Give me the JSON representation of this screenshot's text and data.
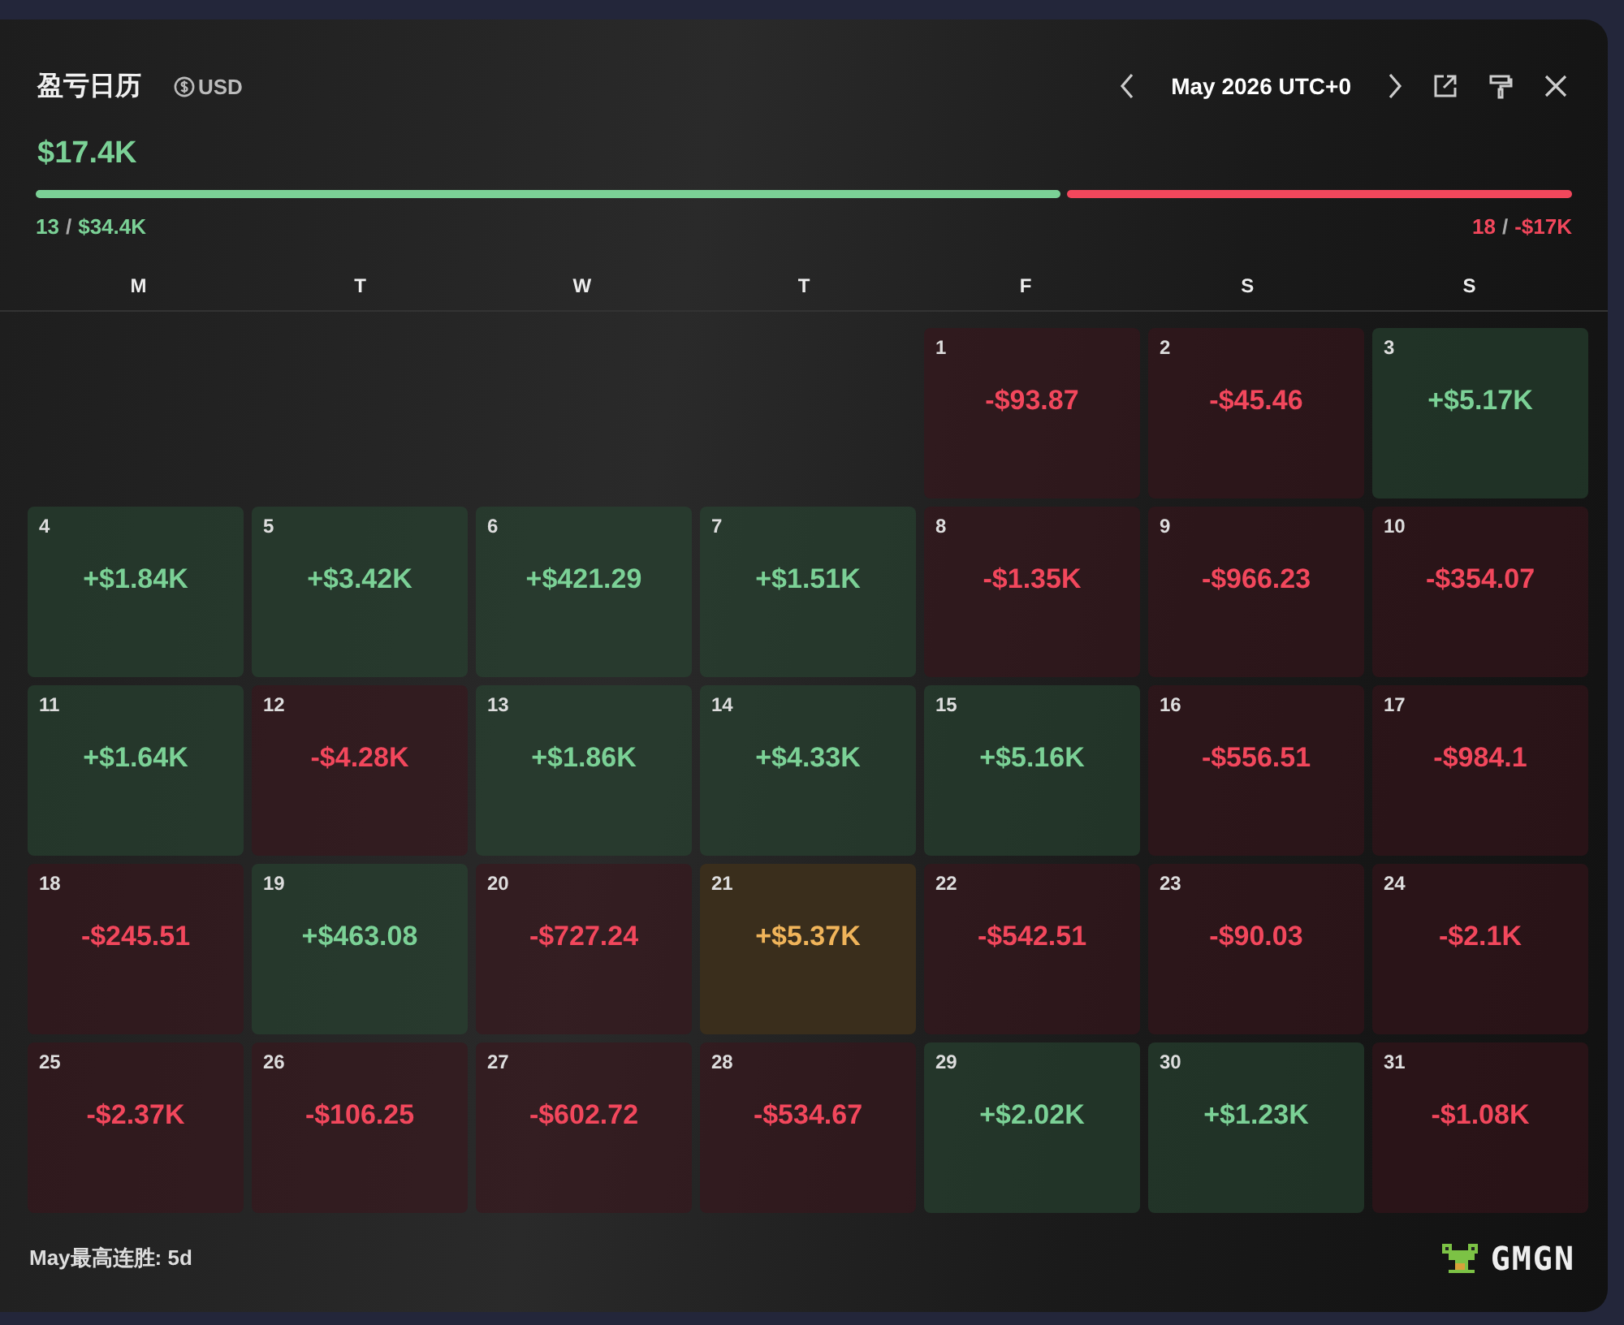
{
  "header": {
    "title": "盈亏日历",
    "currency": "USD",
    "month": "May 2026 UTC+0"
  },
  "summary": {
    "total": "$17.4K",
    "win_separator": "/",
    "loss_separator": "/",
    "win_count": "13",
    "win_amount": "$34.4K",
    "loss_count": "18",
    "loss_amount": "-$17K",
    "level": 0.667
  },
  "weekdays": [
    "M",
    "T",
    "W",
    "T",
    "F",
    "S",
    "S"
  ],
  "days": [
    {
      "day": "1",
      "value": "-$93.87",
      "kind": "loss"
    },
    {
      "day": "2",
      "value": "-$45.46",
      "kind": "loss"
    },
    {
      "day": "3",
      "value": "+$5.17K",
      "kind": "gain"
    },
    {
      "day": "4",
      "value": "+$1.84K",
      "kind": "gain"
    },
    {
      "day": "5",
      "value": "+$3.42K",
      "kind": "gain"
    },
    {
      "day": "6",
      "value": "+$421.29",
      "kind": "gain"
    },
    {
      "day": "7",
      "value": "+$1.51K",
      "kind": "gain"
    },
    {
      "day": "8",
      "value": "-$1.35K",
      "kind": "loss"
    },
    {
      "day": "9",
      "value": "-$966.23",
      "kind": "loss"
    },
    {
      "day": "10",
      "value": "-$354.07",
      "kind": "loss"
    },
    {
      "day": "11",
      "value": "+$1.64K",
      "kind": "gain"
    },
    {
      "day": "12",
      "value": "-$4.28K",
      "kind": "loss"
    },
    {
      "day": "13",
      "value": "+$1.86K",
      "kind": "gain"
    },
    {
      "day": "14",
      "value": "+$4.33K",
      "kind": "gain"
    },
    {
      "day": "15",
      "value": "+$5.16K",
      "kind": "gain"
    },
    {
      "day": "16",
      "value": "-$556.51",
      "kind": "loss"
    },
    {
      "day": "17",
      "value": "-$984.1",
      "kind": "loss"
    },
    {
      "day": "18",
      "value": "-$245.51",
      "kind": "loss"
    },
    {
      "day": "19",
      "value": "+$463.08",
      "kind": "gain"
    },
    {
      "day": "20",
      "value": "-$727.24",
      "kind": "loss"
    },
    {
      "day": "21",
      "value": "+$5.37K",
      "kind": "best"
    },
    {
      "day": "22",
      "value": "-$542.51",
      "kind": "loss"
    },
    {
      "day": "23",
      "value": "-$90.03",
      "kind": "loss"
    },
    {
      "day": "24",
      "value": "-$2.1K",
      "kind": "loss"
    },
    {
      "day": "25",
      "value": "-$2.37K",
      "kind": "loss"
    },
    {
      "day": "26",
      "value": "-$106.25",
      "kind": "loss"
    },
    {
      "day": "27",
      "value": "-$602.72",
      "kind": "loss"
    },
    {
      "day": "28",
      "value": "-$534.67",
      "kind": "loss"
    },
    {
      "day": "29",
      "value": "+$2.02K",
      "kind": "gain"
    },
    {
      "day": "30",
      "value": "+$1.23K",
      "kind": "gain"
    },
    {
      "day": "31",
      "value": "-$1.08K",
      "kind": "loss"
    }
  ],
  "footer": {
    "streak_label": "May最高连胜:",
    "streak_value": "5d",
    "brand": "GMGN"
  }
}
